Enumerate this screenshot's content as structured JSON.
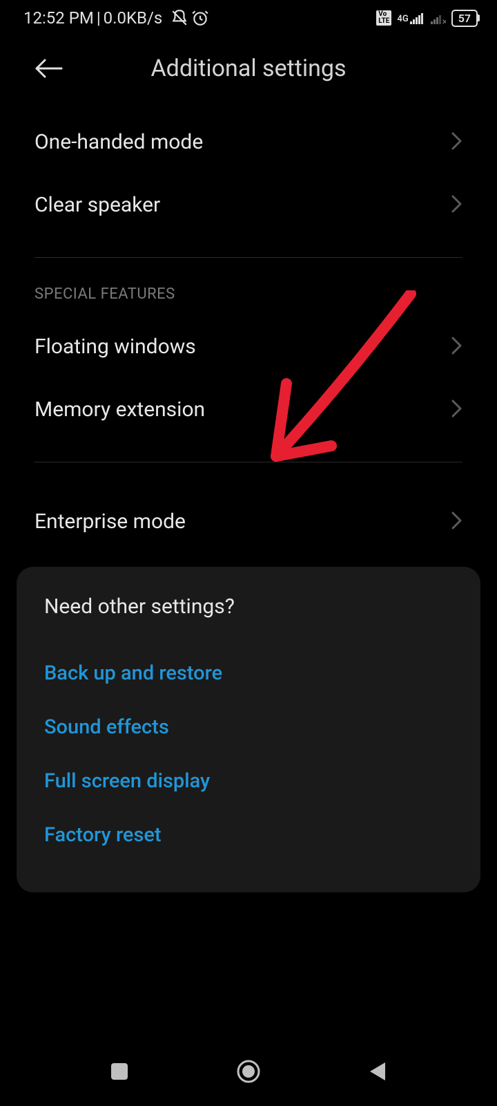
{
  "statusBar": {
    "time": "12:52 PM",
    "separator": " | ",
    "dataRate": "0.0KB/s",
    "networkLabel": "4G",
    "volteLine1": "Vo",
    "volteLine2": "LTE",
    "batteryLevel": "57"
  },
  "header": {
    "title": "Additional settings"
  },
  "items": {
    "oneHanded": "One-handed mode",
    "clearSpeaker": "Clear speaker",
    "floatingWindows": "Floating windows",
    "memoryExtension": "Memory extension",
    "enterpriseMode": "Enterprise mode"
  },
  "sections": {
    "specialFeatures": "SPECIAL FEATURES"
  },
  "card": {
    "title": "Need other settings?",
    "links": {
      "backup": "Back up and restore",
      "sound": "Sound effects",
      "fullscreen": "Full screen display",
      "factoryReset": "Factory reset"
    }
  },
  "annotation": {
    "arrowColor": "#e62030"
  }
}
